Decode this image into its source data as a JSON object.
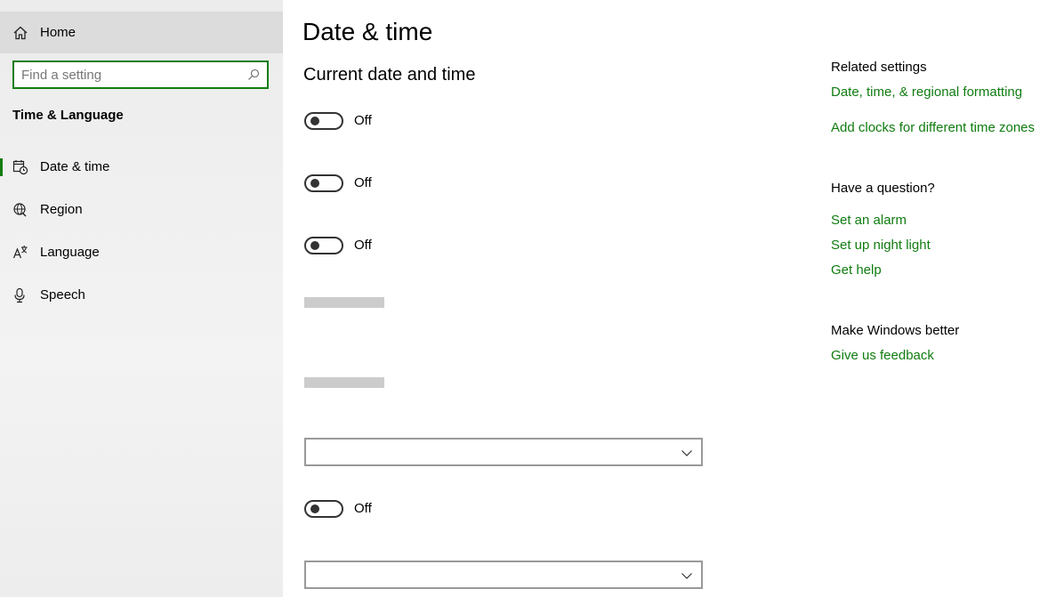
{
  "sidebar": {
    "home_label": "Home",
    "search_placeholder": "Find a setting",
    "section_title": "Time & Language",
    "items": [
      {
        "label": "Date & time",
        "icon": "calendar-clock-icon",
        "active": true
      },
      {
        "label": "Region",
        "icon": "globe-icon",
        "active": false
      },
      {
        "label": "Language",
        "icon": "language-icon",
        "active": false
      },
      {
        "label": "Speech",
        "icon": "microphone-icon",
        "active": false
      }
    ]
  },
  "main": {
    "title": "Date & time",
    "subtitle": "Current date and time",
    "toggles": [
      {
        "state": "Off"
      },
      {
        "state": "Off"
      },
      {
        "state": "Off"
      },
      {
        "state": "Off"
      }
    ]
  },
  "related": {
    "heading": "Related settings",
    "links": [
      "Date, time, & regional formatting",
      "Add clocks for different time zones"
    ]
  },
  "question": {
    "heading": "Have a question?",
    "links": [
      "Set an alarm",
      "Set up night light",
      "Get help"
    ]
  },
  "feedback": {
    "heading": "Make Windows better",
    "link": "Give us feedback"
  },
  "colors": {
    "accent": "#107c10",
    "sidebar_bg": "#f0f0f0",
    "placeholder_bar": "#cccccc"
  }
}
